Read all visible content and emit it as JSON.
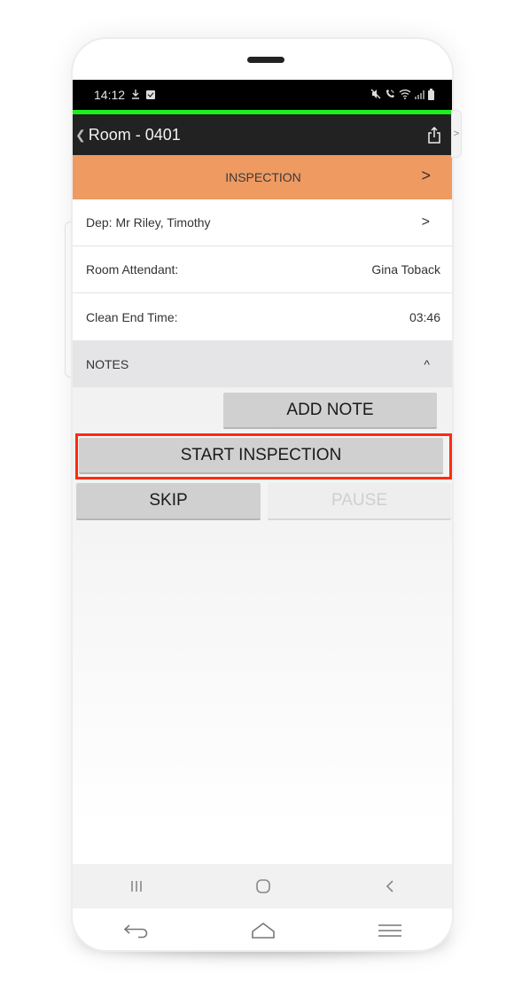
{
  "status_bar": {
    "time": "14:12",
    "left_icons": [
      "download-icon",
      "checkbox-notification-icon"
    ],
    "right_icons": [
      "mute-icon",
      "wifi-call-icon",
      "wifi-icon",
      "signal-icon",
      "battery-icon"
    ]
  },
  "nav": {
    "back_label": "Room - 0401",
    "share_icon": "share-icon",
    "side_tab_right_glyph": ">"
  },
  "inspection_bar": {
    "label": "INSPECTION",
    "arrow": ">"
  },
  "rows": [
    {
      "label": "Dep: Mr Riley, Timothy",
      "value": "",
      "chevron": ">"
    },
    {
      "label": "Room Attendant:",
      "value": "Gina Toback"
    },
    {
      "label": "Clean End Time:",
      "value": "03:46"
    }
  ],
  "notes": {
    "label": "NOTES",
    "caret": "^"
  },
  "buttons": {
    "add_note": "ADD NOTE",
    "start_inspection": "START INSPECTION",
    "skip": "SKIP",
    "pause": "PAUSE"
  },
  "colors": {
    "accent_orange": "#ee9a61",
    "progress_green": "#1bf01b",
    "highlight_red": "#ff2a10",
    "nav_dark": "#222222"
  },
  "system_nav": [
    "recent-apps-icon",
    "home-icon",
    "back-icon"
  ],
  "app_nav": [
    "return-icon",
    "home-outline-icon",
    "menu-icon"
  ]
}
